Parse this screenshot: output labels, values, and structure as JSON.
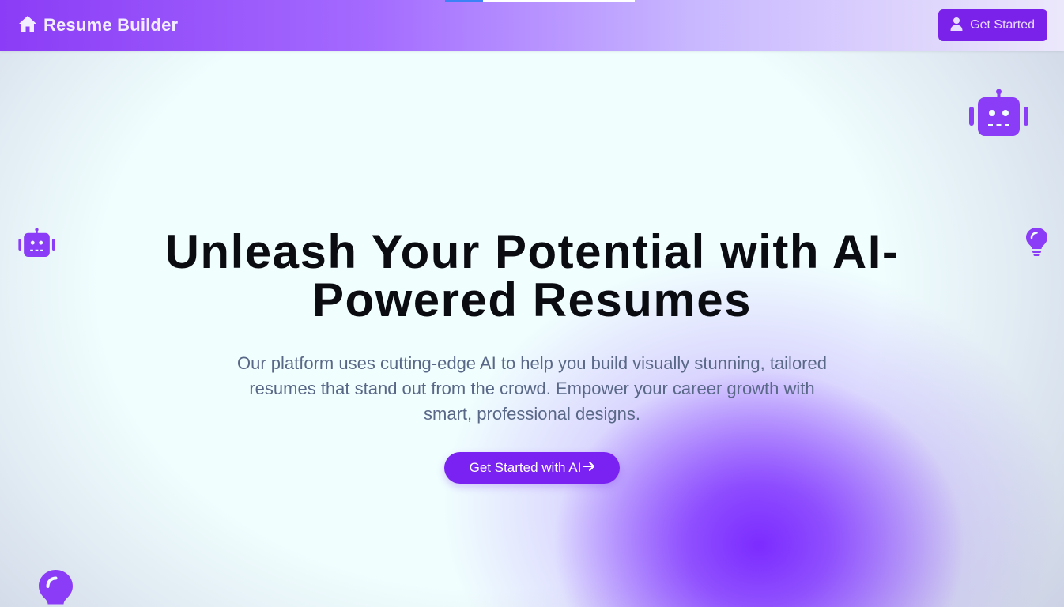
{
  "nav": {
    "brand_icon": "home-icon",
    "brand_title": "Resume Builder",
    "cta_icon": "user-icon",
    "cta_label": "Get Started"
  },
  "hero": {
    "title": "Unleash Your Potential with AI-Powered Resumes",
    "subtitle": "Our platform uses cutting-edge AI to help you build visually stunning, tailored resumes that stand out from the crowd. Empower your career growth with smart, professional designs.",
    "cta_label": "Get Started with AI",
    "cta_icon": "arrow-right-icon"
  },
  "decorations": [
    "robot-icon",
    "robot-icon",
    "lightbulb-icon",
    "lightbulb-icon"
  ],
  "colors": {
    "accent": "#7a22f2",
    "nav_gradient_start": "#8b3cf6",
    "icon_purple": "#8b3cf6",
    "title_text": "#0b0b12",
    "subtitle_text": "#5a6888",
    "background": "#f0fefe"
  }
}
